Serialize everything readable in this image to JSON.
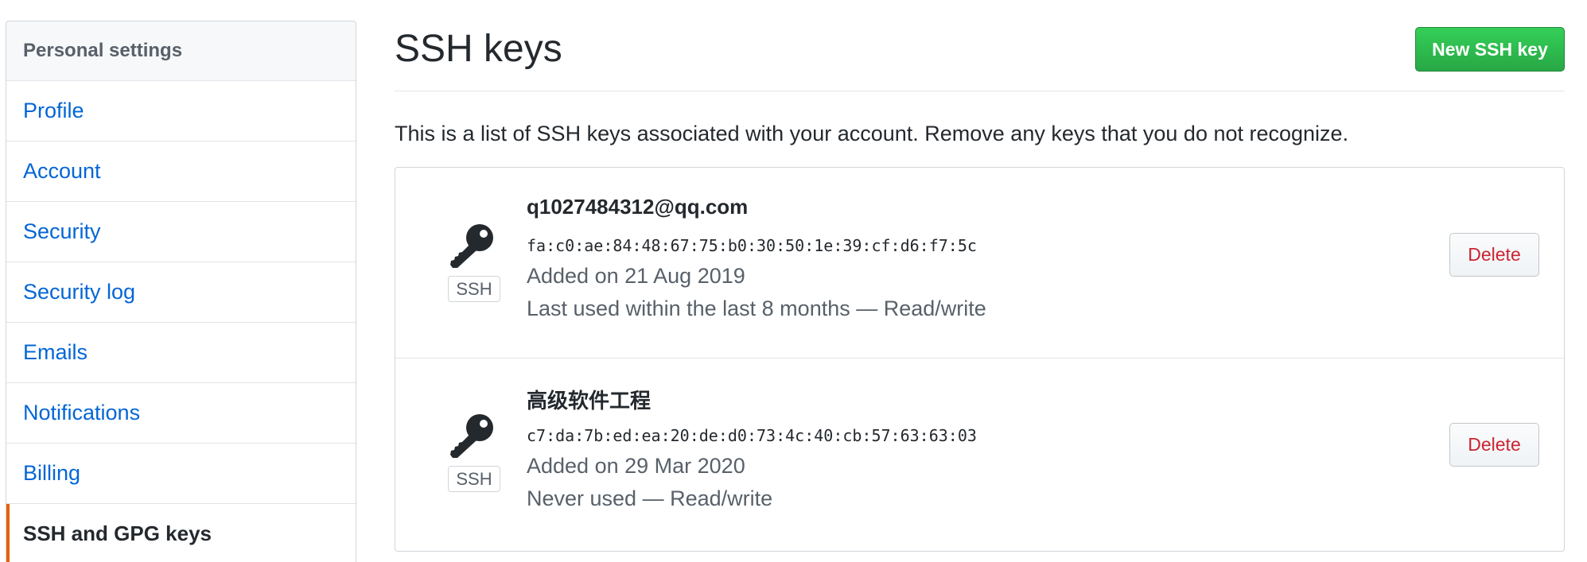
{
  "sidebar": {
    "header": "Personal settings",
    "items": [
      {
        "label": "Profile"
      },
      {
        "label": "Account"
      },
      {
        "label": "Security"
      },
      {
        "label": "Security log"
      },
      {
        "label": "Emails"
      },
      {
        "label": "Notifications"
      },
      {
        "label": "Billing"
      },
      {
        "label": "SSH and GPG keys",
        "selected": true
      }
    ]
  },
  "main": {
    "title": "SSH keys",
    "new_button": "New SSH key",
    "description": "This is a list of SSH keys associated with your account. Remove any keys that you do not recognize.",
    "keys": [
      {
        "title": "q1027484312@qq.com",
        "type_label": "SSH",
        "fingerprint": "fa:c0:ae:84:48:67:75:b0:30:50:1e:39:cf:d6:f7:5c",
        "added": "Added on 21 Aug 2019",
        "usage": "Last used within the last 8 months — Read/write",
        "delete_label": "Delete"
      },
      {
        "title": "高级软件工程",
        "type_label": "SSH",
        "fingerprint": "c7:da:7b:ed:ea:20:de:d0:73:4c:40:cb:57:63:63:03",
        "added": "Added on 29 Mar 2020",
        "usage": "Never used — Read/write",
        "delete_label": "Delete"
      }
    ]
  },
  "colors": {
    "link": "#0366d6",
    "selected_accent": "#e36209",
    "primary_button": "#28a745",
    "danger_text": "#cb2431",
    "key_icon": "#24292e"
  },
  "icons": {
    "key": "key-icon"
  }
}
